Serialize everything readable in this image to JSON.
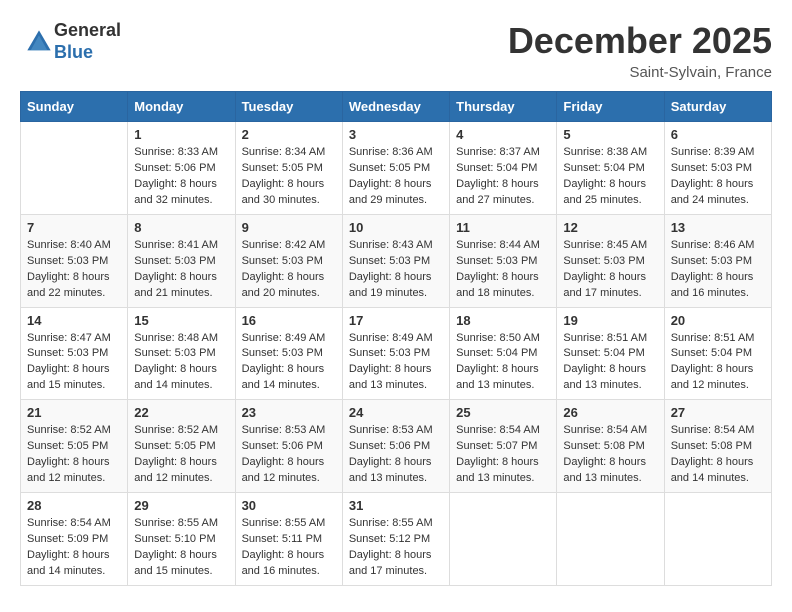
{
  "logo": {
    "general": "General",
    "blue": "Blue"
  },
  "title": "December 2025",
  "location": "Saint-Sylvain, France",
  "days_of_week": [
    "Sunday",
    "Monday",
    "Tuesday",
    "Wednesday",
    "Thursday",
    "Friday",
    "Saturday"
  ],
  "weeks": [
    [
      {
        "day": "",
        "sunrise": "",
        "sunset": "",
        "daylight": ""
      },
      {
        "day": "1",
        "sunrise": "Sunrise: 8:33 AM",
        "sunset": "Sunset: 5:06 PM",
        "daylight": "Daylight: 8 hours and 32 minutes."
      },
      {
        "day": "2",
        "sunrise": "Sunrise: 8:34 AM",
        "sunset": "Sunset: 5:05 PM",
        "daylight": "Daylight: 8 hours and 30 minutes."
      },
      {
        "day": "3",
        "sunrise": "Sunrise: 8:36 AM",
        "sunset": "Sunset: 5:05 PM",
        "daylight": "Daylight: 8 hours and 29 minutes."
      },
      {
        "day": "4",
        "sunrise": "Sunrise: 8:37 AM",
        "sunset": "Sunset: 5:04 PM",
        "daylight": "Daylight: 8 hours and 27 minutes."
      },
      {
        "day": "5",
        "sunrise": "Sunrise: 8:38 AM",
        "sunset": "Sunset: 5:04 PM",
        "daylight": "Daylight: 8 hours and 25 minutes."
      },
      {
        "day": "6",
        "sunrise": "Sunrise: 8:39 AM",
        "sunset": "Sunset: 5:03 PM",
        "daylight": "Daylight: 8 hours and 24 minutes."
      }
    ],
    [
      {
        "day": "7",
        "sunrise": "Sunrise: 8:40 AM",
        "sunset": "Sunset: 5:03 PM",
        "daylight": "Daylight: 8 hours and 22 minutes."
      },
      {
        "day": "8",
        "sunrise": "Sunrise: 8:41 AM",
        "sunset": "Sunset: 5:03 PM",
        "daylight": "Daylight: 8 hours and 21 minutes."
      },
      {
        "day": "9",
        "sunrise": "Sunrise: 8:42 AM",
        "sunset": "Sunset: 5:03 PM",
        "daylight": "Daylight: 8 hours and 20 minutes."
      },
      {
        "day": "10",
        "sunrise": "Sunrise: 8:43 AM",
        "sunset": "Sunset: 5:03 PM",
        "daylight": "Daylight: 8 hours and 19 minutes."
      },
      {
        "day": "11",
        "sunrise": "Sunrise: 8:44 AM",
        "sunset": "Sunset: 5:03 PM",
        "daylight": "Daylight: 8 hours and 18 minutes."
      },
      {
        "day": "12",
        "sunrise": "Sunrise: 8:45 AM",
        "sunset": "Sunset: 5:03 PM",
        "daylight": "Daylight: 8 hours and 17 minutes."
      },
      {
        "day": "13",
        "sunrise": "Sunrise: 8:46 AM",
        "sunset": "Sunset: 5:03 PM",
        "daylight": "Daylight: 8 hours and 16 minutes."
      }
    ],
    [
      {
        "day": "14",
        "sunrise": "Sunrise: 8:47 AM",
        "sunset": "Sunset: 5:03 PM",
        "daylight": "Daylight: 8 hours and 15 minutes."
      },
      {
        "day": "15",
        "sunrise": "Sunrise: 8:48 AM",
        "sunset": "Sunset: 5:03 PM",
        "daylight": "Daylight: 8 hours and 14 minutes."
      },
      {
        "day": "16",
        "sunrise": "Sunrise: 8:49 AM",
        "sunset": "Sunset: 5:03 PM",
        "daylight": "Daylight: 8 hours and 14 minutes."
      },
      {
        "day": "17",
        "sunrise": "Sunrise: 8:49 AM",
        "sunset": "Sunset: 5:03 PM",
        "daylight": "Daylight: 8 hours and 13 minutes."
      },
      {
        "day": "18",
        "sunrise": "Sunrise: 8:50 AM",
        "sunset": "Sunset: 5:04 PM",
        "daylight": "Daylight: 8 hours and 13 minutes."
      },
      {
        "day": "19",
        "sunrise": "Sunrise: 8:51 AM",
        "sunset": "Sunset: 5:04 PM",
        "daylight": "Daylight: 8 hours and 13 minutes."
      },
      {
        "day": "20",
        "sunrise": "Sunrise: 8:51 AM",
        "sunset": "Sunset: 5:04 PM",
        "daylight": "Daylight: 8 hours and 12 minutes."
      }
    ],
    [
      {
        "day": "21",
        "sunrise": "Sunrise: 8:52 AM",
        "sunset": "Sunset: 5:05 PM",
        "daylight": "Daylight: 8 hours and 12 minutes."
      },
      {
        "day": "22",
        "sunrise": "Sunrise: 8:52 AM",
        "sunset": "Sunset: 5:05 PM",
        "daylight": "Daylight: 8 hours and 12 minutes."
      },
      {
        "day": "23",
        "sunrise": "Sunrise: 8:53 AM",
        "sunset": "Sunset: 5:06 PM",
        "daylight": "Daylight: 8 hours and 12 minutes."
      },
      {
        "day": "24",
        "sunrise": "Sunrise: 8:53 AM",
        "sunset": "Sunset: 5:06 PM",
        "daylight": "Daylight: 8 hours and 13 minutes."
      },
      {
        "day": "25",
        "sunrise": "Sunrise: 8:54 AM",
        "sunset": "Sunset: 5:07 PM",
        "daylight": "Daylight: 8 hours and 13 minutes."
      },
      {
        "day": "26",
        "sunrise": "Sunrise: 8:54 AM",
        "sunset": "Sunset: 5:08 PM",
        "daylight": "Daylight: 8 hours and 13 minutes."
      },
      {
        "day": "27",
        "sunrise": "Sunrise: 8:54 AM",
        "sunset": "Sunset: 5:08 PM",
        "daylight": "Daylight: 8 hours and 14 minutes."
      }
    ],
    [
      {
        "day": "28",
        "sunrise": "Sunrise: 8:54 AM",
        "sunset": "Sunset: 5:09 PM",
        "daylight": "Daylight: 8 hours and 14 minutes."
      },
      {
        "day": "29",
        "sunrise": "Sunrise: 8:55 AM",
        "sunset": "Sunset: 5:10 PM",
        "daylight": "Daylight: 8 hours and 15 minutes."
      },
      {
        "day": "30",
        "sunrise": "Sunrise: 8:55 AM",
        "sunset": "Sunset: 5:11 PM",
        "daylight": "Daylight: 8 hours and 16 minutes."
      },
      {
        "day": "31",
        "sunrise": "Sunrise: 8:55 AM",
        "sunset": "Sunset: 5:12 PM",
        "daylight": "Daylight: 8 hours and 17 minutes."
      },
      {
        "day": "",
        "sunrise": "",
        "sunset": "",
        "daylight": ""
      },
      {
        "day": "",
        "sunrise": "",
        "sunset": "",
        "daylight": ""
      },
      {
        "day": "",
        "sunrise": "",
        "sunset": "",
        "daylight": ""
      }
    ]
  ]
}
